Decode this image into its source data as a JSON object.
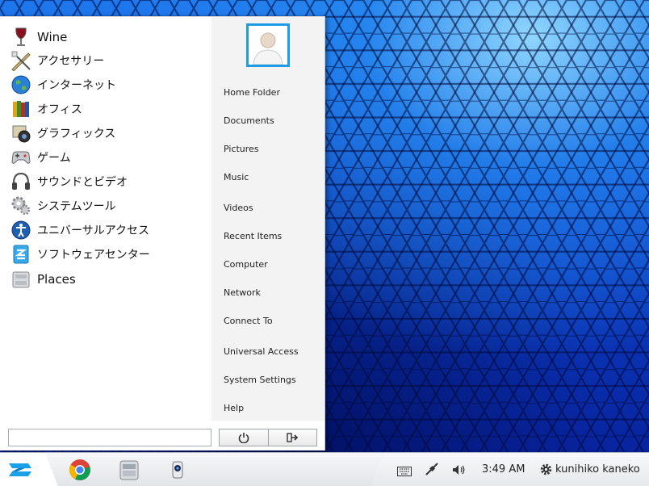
{
  "apps": [
    {
      "label": "Wine",
      "icon": "wine-icon"
    },
    {
      "label": "アクセサリー",
      "icon": "accessories-icon"
    },
    {
      "label": "インターネット",
      "icon": "internet-icon"
    },
    {
      "label": "オフィス",
      "icon": "office-icon"
    },
    {
      "label": "グラフィックス",
      "icon": "graphics-icon"
    },
    {
      "label": "ゲーム",
      "icon": "games-icon"
    },
    {
      "label": "サウンドとビデオ",
      "icon": "sound-video-icon"
    },
    {
      "label": "システムツール",
      "icon": "system-tools-icon"
    },
    {
      "label": "ユニバーサルアクセス",
      "icon": "universal-access-icon"
    },
    {
      "label": "ソフトウェアセンター",
      "icon": "software-center-icon"
    },
    {
      "label": "Places",
      "icon": "places-icon"
    }
  ],
  "places": [
    "Home Folder",
    "Documents",
    "Pictures",
    "Music",
    "Videos",
    "Recent Items",
    "Computer",
    "Network",
    "Connect To",
    "Universal Access",
    "System Settings",
    "Help"
  ],
  "search": {
    "value": "",
    "placeholder": ""
  },
  "buttons": {
    "power_icon": "power-icon",
    "logout_icon": "logout-icon"
  },
  "taskbar": {
    "apps": [
      "chrome-icon",
      "files-icon",
      "webcam-icon"
    ],
    "clock": "3:49 AM",
    "user": "kunihiko kaneko"
  },
  "colors": {
    "accent": "#1d9ce8",
    "desktop": "#0d48d2"
  }
}
